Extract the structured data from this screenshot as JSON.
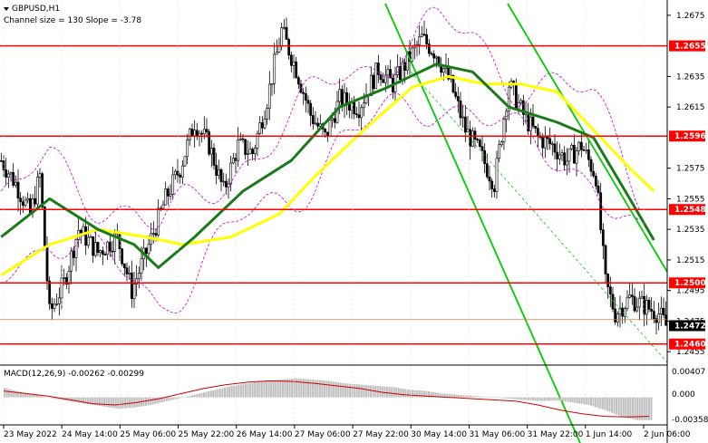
{
  "header": {
    "symbol": "GBPUSD,H1",
    "channel": "Channel size = 130 Slope = -3.78"
  },
  "macd": {
    "label": "MACD(12,26,9) -0.00262 -0.00299",
    "ticks": [
      "0.00407",
      "0.000",
      "-0.00358"
    ]
  },
  "colors": {
    "background": "#ffffff",
    "level_line": "#ff0000",
    "ma_fast": "#1a7a1a",
    "ma_slow": "#ffff00",
    "channel": "#00cc00",
    "bollinger": "#cc00cc",
    "candle": "#000000",
    "macd_hist": "#c0c0c0",
    "macd_signal": "#cc0000"
  },
  "chart_data": {
    "type": "candlestick",
    "symbol": "GBPUSD",
    "timeframe": "H1",
    "y_ticks": [
      "1.2675",
      "1.2655",
      "1.2635",
      "1.2615",
      "1.2596",
      "1.2575",
      "1.2555",
      "1.2548",
      "1.2535",
      "1.2515",
      "1.2500",
      "1.2495",
      "1.2475",
      "1.2472",
      "1.2460",
      "1.2455"
    ],
    "ylim": [
      1.2448,
      1.2685
    ],
    "levels": [
      {
        "label": "1.2655",
        "value": 1.2655
      },
      {
        "label": "1.2596",
        "value": 1.2596
      },
      {
        "label": "1.2548",
        "value": 1.2548
      },
      {
        "label": "1.2500",
        "value": 1.25
      },
      {
        "label": "1.2460",
        "value": 1.246
      }
    ],
    "current_price": {
      "label": "1.2472",
      "value": 1.2472
    },
    "x_labels": [
      "23 May 2022",
      "24 May 14:00",
      "25 May 06:00",
      "25 May 22:00",
      "26 May 14:00",
      "27 May 06:00",
      "27 May 22:00",
      "30 May 14:00",
      "31 May 06:00",
      "31 May 22:00",
      "1 Jun 14:00",
      "2 Jun 06:00"
    ],
    "close_path": [
      [
        0,
        1.258
      ],
      [
        6,
        1.2565
      ],
      [
        12,
        1.2545
      ],
      [
        16,
        1.257
      ],
      [
        20,
        1.248
      ],
      [
        26,
        1.25
      ],
      [
        32,
        1.2535
      ],
      [
        40,
        1.252
      ],
      [
        48,
        1.253
      ],
      [
        54,
        1.2495
      ],
      [
        60,
        1.252
      ],
      [
        68,
        1.2555
      ],
      [
        74,
        1.2575
      ],
      [
        80,
        1.2605
      ],
      [
        86,
        1.259
      ],
      [
        92,
        1.256
      ],
      [
        98,
        1.259
      ],
      [
        104,
        1.2585
      ],
      [
        110,
        1.262
      ],
      [
        116,
        1.2665
      ],
      [
        122,
        1.264
      ],
      [
        128,
        1.261
      ],
      [
        134,
        1.2595
      ],
      [
        140,
        1.262
      ],
      [
        148,
        1.2615
      ],
      [
        156,
        1.264
      ],
      [
        162,
        1.263
      ],
      [
        168,
        1.2645
      ],
      [
        174,
        1.266
      ],
      [
        180,
        1.265
      ],
      [
        186,
        1.263
      ],
      [
        192,
        1.26
      ],
      [
        198,
        1.2585
      ],
      [
        204,
        1.2565
      ],
      [
        210,
        1.263
      ],
      [
        216,
        1.261
      ],
      [
        222,
        1.2595
      ],
      [
        228,
        1.259
      ],
      [
        234,
        1.258
      ],
      [
        240,
        1.259
      ],
      [
        246,
        1.257
      ],
      [
        250,
        1.25
      ],
      [
        254,
        1.248
      ],
      [
        260,
        1.249
      ],
      [
        266,
        1.2485
      ],
      [
        272,
        1.248
      ],
      [
        275,
        1.2472
      ]
    ],
    "ma_fast": [
      [
        0,
        1.253
      ],
      [
        20,
        1.2555
      ],
      [
        40,
        1.2535
      ],
      [
        55,
        1.2525
      ],
      [
        65,
        1.251
      ],
      [
        80,
        1.253
      ],
      [
        100,
        1.256
      ],
      [
        120,
        1.258
      ],
      [
        140,
        1.2615
      ],
      [
        160,
        1.2628
      ],
      [
        180,
        1.2643
      ],
      [
        195,
        1.2638
      ],
      [
        210,
        1.2615
      ],
      [
        230,
        1.2605
      ],
      [
        245,
        1.2595
      ],
      [
        260,
        1.2555
      ],
      [
        270,
        1.2528
      ]
    ],
    "ma_slow": [
      [
        0,
        1.2505
      ],
      [
        20,
        1.2525
      ],
      [
        40,
        1.2535
      ],
      [
        60,
        1.253
      ],
      [
        75,
        1.2525
      ],
      [
        95,
        1.253
      ],
      [
        115,
        1.2545
      ],
      [
        130,
        1.257
      ],
      [
        150,
        1.26
      ],
      [
        170,
        1.2628
      ],
      [
        185,
        1.2635
      ],
      [
        200,
        1.263
      ],
      [
        215,
        1.263
      ],
      [
        230,
        1.2625
      ],
      [
        245,
        1.26
      ],
      [
        260,
        1.2575
      ],
      [
        270,
        1.256
      ]
    ],
    "macd_histogram": [
      0.0015,
      0.0008,
      0.0004,
      -0.0002,
      -0.0006,
      -0.001,
      -0.0014,
      -0.0018,
      -0.0016,
      -0.0012,
      -0.0006,
      0.0,
      0.0006,
      0.0012,
      0.0018,
      0.0022,
      0.0026,
      0.0028,
      0.003,
      0.0028,
      0.0026,
      0.0022,
      0.002,
      0.0018,
      0.0016,
      0.0012,
      0.001,
      0.0006,
      0.0004,
      0.0002,
      0.0,
      -0.0002,
      -0.0004,
      -0.0006,
      -0.0005,
      -0.0008,
      -0.0012,
      -0.002,
      -0.003,
      -0.0036
    ],
    "macd_signal": [
      0.001,
      0.0006,
      0.0002,
      -0.0004,
      -0.001,
      -0.0012,
      -0.0008,
      -0.0002,
      0.0006,
      0.0014,
      0.002,
      0.0024,
      0.0026,
      0.0025,
      0.0022,
      0.0018,
      0.0014,
      0.0008,
      0.0004,
      0.0002,
      0.0,
      -0.0002,
      -0.0004,
      -0.0006,
      -0.0012,
      -0.002,
      -0.0026,
      -0.003,
      -0.0031,
      -0.003
    ],
    "macd_ylim": [
      -0.0042,
      0.0048
    ]
  }
}
